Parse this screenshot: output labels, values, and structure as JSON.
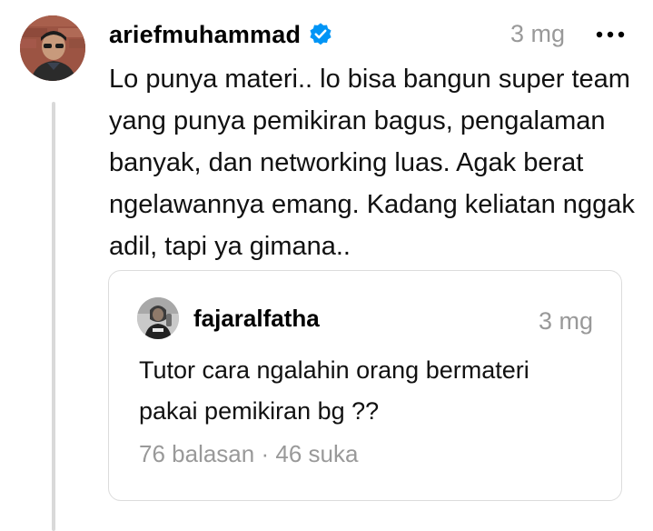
{
  "post": {
    "username": "ariefmuhammad",
    "time": "3 mg",
    "more_icon": "more-icon",
    "text": "Lo punya materi.. lo bisa bangun super team yang punya pemikiran bagus, pengalaman banyak, dan networking luas. Agak berat ngelawannya emang. Kadang keliatan nggak adil, tapi ya gimana.."
  },
  "quoted": {
    "username": "fajaralfatha",
    "time": "3 mg",
    "text": "Tutor cara ngalahin orang bermateri pakai pemikiran bg ??",
    "replies": "76 balasan",
    "separator": "·",
    "likes": "46 suka"
  },
  "colors": {
    "verified": "#0095f6",
    "muted_text": "#999999",
    "thread_line": "#d9d9d9"
  }
}
